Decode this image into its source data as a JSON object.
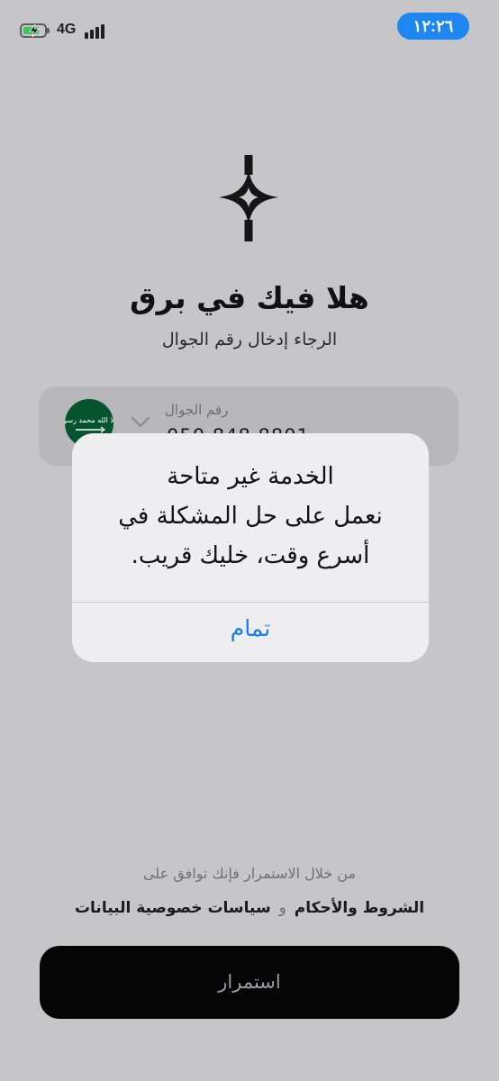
{
  "status_bar": {
    "network": "4G",
    "time": "١٢:٢٦",
    "battery_level": 0.75,
    "signal_bars": 4
  },
  "welcome": {
    "title": "هلا فيك في برق",
    "subtitle": "الرجاء إدخال رقم الجوال"
  },
  "phone_input": {
    "label": "رقم الجوال",
    "value": "050 848 8801",
    "country": "Saudi Arabia",
    "flag_text": "لا إله إلا الله محمد رسول الله"
  },
  "alert": {
    "line1": "الخدمة غير متاحة",
    "line2": "نعمل على حل المشكلة في",
    "line3": "أسرع وقت، خليك قريب.",
    "ok_label": "تمام"
  },
  "consent": {
    "intro": "من خلال الاستمرار فإنك توافق على",
    "terms": "الشروط والأحكام",
    "connector": "و",
    "privacy": "سياسات خصوصية البيانات"
  },
  "continue_label": "استمرار",
  "colors": {
    "background": "#c6c6c9",
    "accent_blue": "#1a7cea",
    "clock_pill": "#1e86f0",
    "flag_green": "#06542f",
    "battery_green": "#35c759"
  }
}
